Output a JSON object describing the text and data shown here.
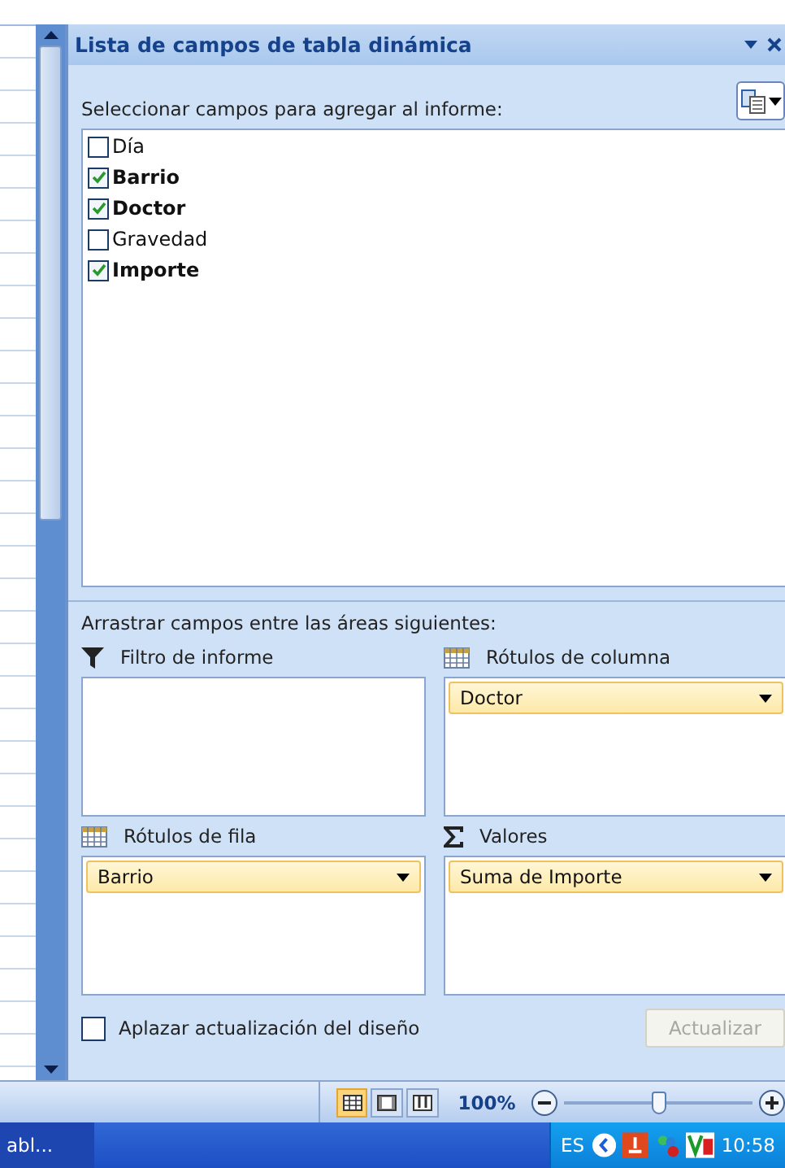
{
  "pane": {
    "title": "Lista de campos de tabla dinámica",
    "fields_label": "Seleccionar campos para agregar al informe:",
    "fields": [
      {
        "label": "Día",
        "checked": false
      },
      {
        "label": "Barrio",
        "checked": true
      },
      {
        "label": "Doctor",
        "checked": true
      },
      {
        "label": "Gravedad",
        "checked": false
      },
      {
        "label": "Importe",
        "checked": true
      }
    ],
    "areas_label": "Arrastrar campos entre las áreas siguientes:",
    "areas": [
      {
        "kind": "filter",
        "title": "Filtro de informe"
      },
      {
        "kind": "grid",
        "title": "Rótulos de columna",
        "items": [
          "Doctor"
        ]
      },
      {
        "kind": "grid",
        "title": "Rótulos de fila",
        "items": [
          "Barrio"
        ]
      },
      {
        "kind": "sum",
        "title": "Valores",
        "items": [
          "Suma de Importe"
        ]
      }
    ],
    "defer": {
      "label": "Aplazar actualización del diseño",
      "checked": false
    },
    "update_button": {
      "label": "Actualizar",
      "disabled": true
    }
  },
  "status_bar": {
    "views": [
      {
        "selected": true
      },
      {
        "selected": false
      },
      {
        "selected": false
      }
    ],
    "zoom": "100%",
    "level": 0.5
  },
  "taskbar": {
    "task": "abl...",
    "language": "ES",
    "clock": "10:58"
  }
}
